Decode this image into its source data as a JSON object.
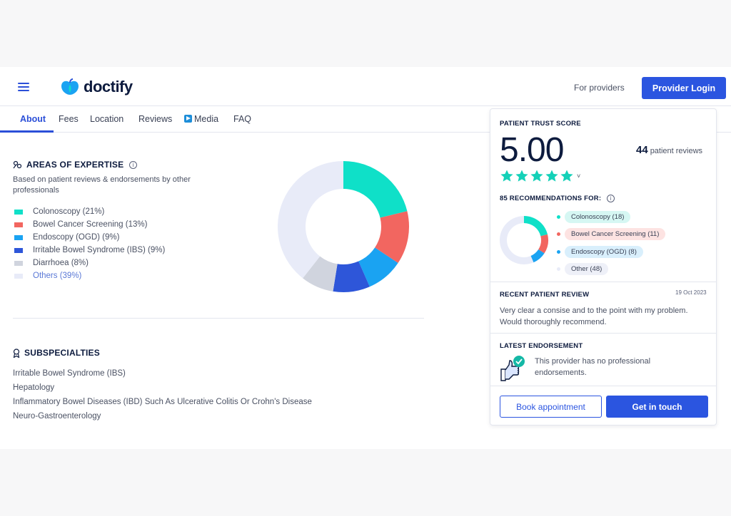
{
  "header": {
    "logo_text": "doctify",
    "for_providers": "For providers",
    "provider_login": "Provider Login"
  },
  "tabs": [
    {
      "label": "About"
    },
    {
      "label": "Fees"
    },
    {
      "label": "Location"
    },
    {
      "label": "Reviews"
    },
    {
      "label": "Media"
    },
    {
      "label": "FAQ"
    }
  ],
  "expertise": {
    "title": "AREAS OF EXPERTISE",
    "subtitle": "Based on patient reviews & endorsements by other professionals",
    "items": [
      {
        "label": "Colonoscopy (21%)",
        "percent": 21,
        "color": "#0fe0c8"
      },
      {
        "label": "Bowel Cancer Screening (13%)",
        "percent": 13,
        "color": "#f26660"
      },
      {
        "label": "Endoscopy (OGD) (9%)",
        "percent": 9,
        "color": "#1aa3f2"
      },
      {
        "label": "Irritable Bowel Syndrome (IBS) (9%)",
        "percent": 9,
        "color": "#2e56d9"
      },
      {
        "label": "Diarrhoea (8%)",
        "percent": 8,
        "color": "#d0d4de"
      },
      {
        "label": "Others (39%)",
        "percent": 39,
        "color": "#e8ebf8"
      }
    ]
  },
  "subspecialties": {
    "title": "SUBSPECIALTIES",
    "items": [
      "Irritable Bowel Syndrome (IBS)",
      "Hepatology",
      "Inflammatory Bowel Diseases (IBD) Such As Ulcerative Colitis Or Crohn's Disease",
      "Neuro-Gastroenterology"
    ]
  },
  "trust": {
    "label": "PATIENT TRUST SCORE",
    "score": "5.00",
    "review_count": "44",
    "review_suffix": "patient reviews",
    "stars": 5,
    "recommendations_label": "85 RECOMMENDATIONS FOR:",
    "recommendations": [
      {
        "label": "Colonoscopy (18)",
        "count": 18,
        "color": "#0fe0c8",
        "bg": "#d6f7f3"
      },
      {
        "label": "Bowel Cancer Screening (11)",
        "count": 11,
        "color": "#f26660",
        "bg": "#fde3e2"
      },
      {
        "label": "Endoscopy (OGD) (8)",
        "count": 8,
        "color": "#1aa3f2",
        "bg": "#d9effc"
      },
      {
        "label": "Other (48)",
        "count": 48,
        "color": "#e8ebf8",
        "bg": "#eef0f8"
      }
    ],
    "review_label": "RECENT PATIENT REVIEW",
    "review_date": "19 Oct 2023",
    "review_text": "Very clear a consise and to the point with my problem. Would thoroughly recommend.",
    "endorse_label": "LATEST ENDORSEMENT",
    "endorse_text": "This provider has no professional endorsements.",
    "book_button": "Book appointment",
    "touch_button": "Get in touch"
  }
}
